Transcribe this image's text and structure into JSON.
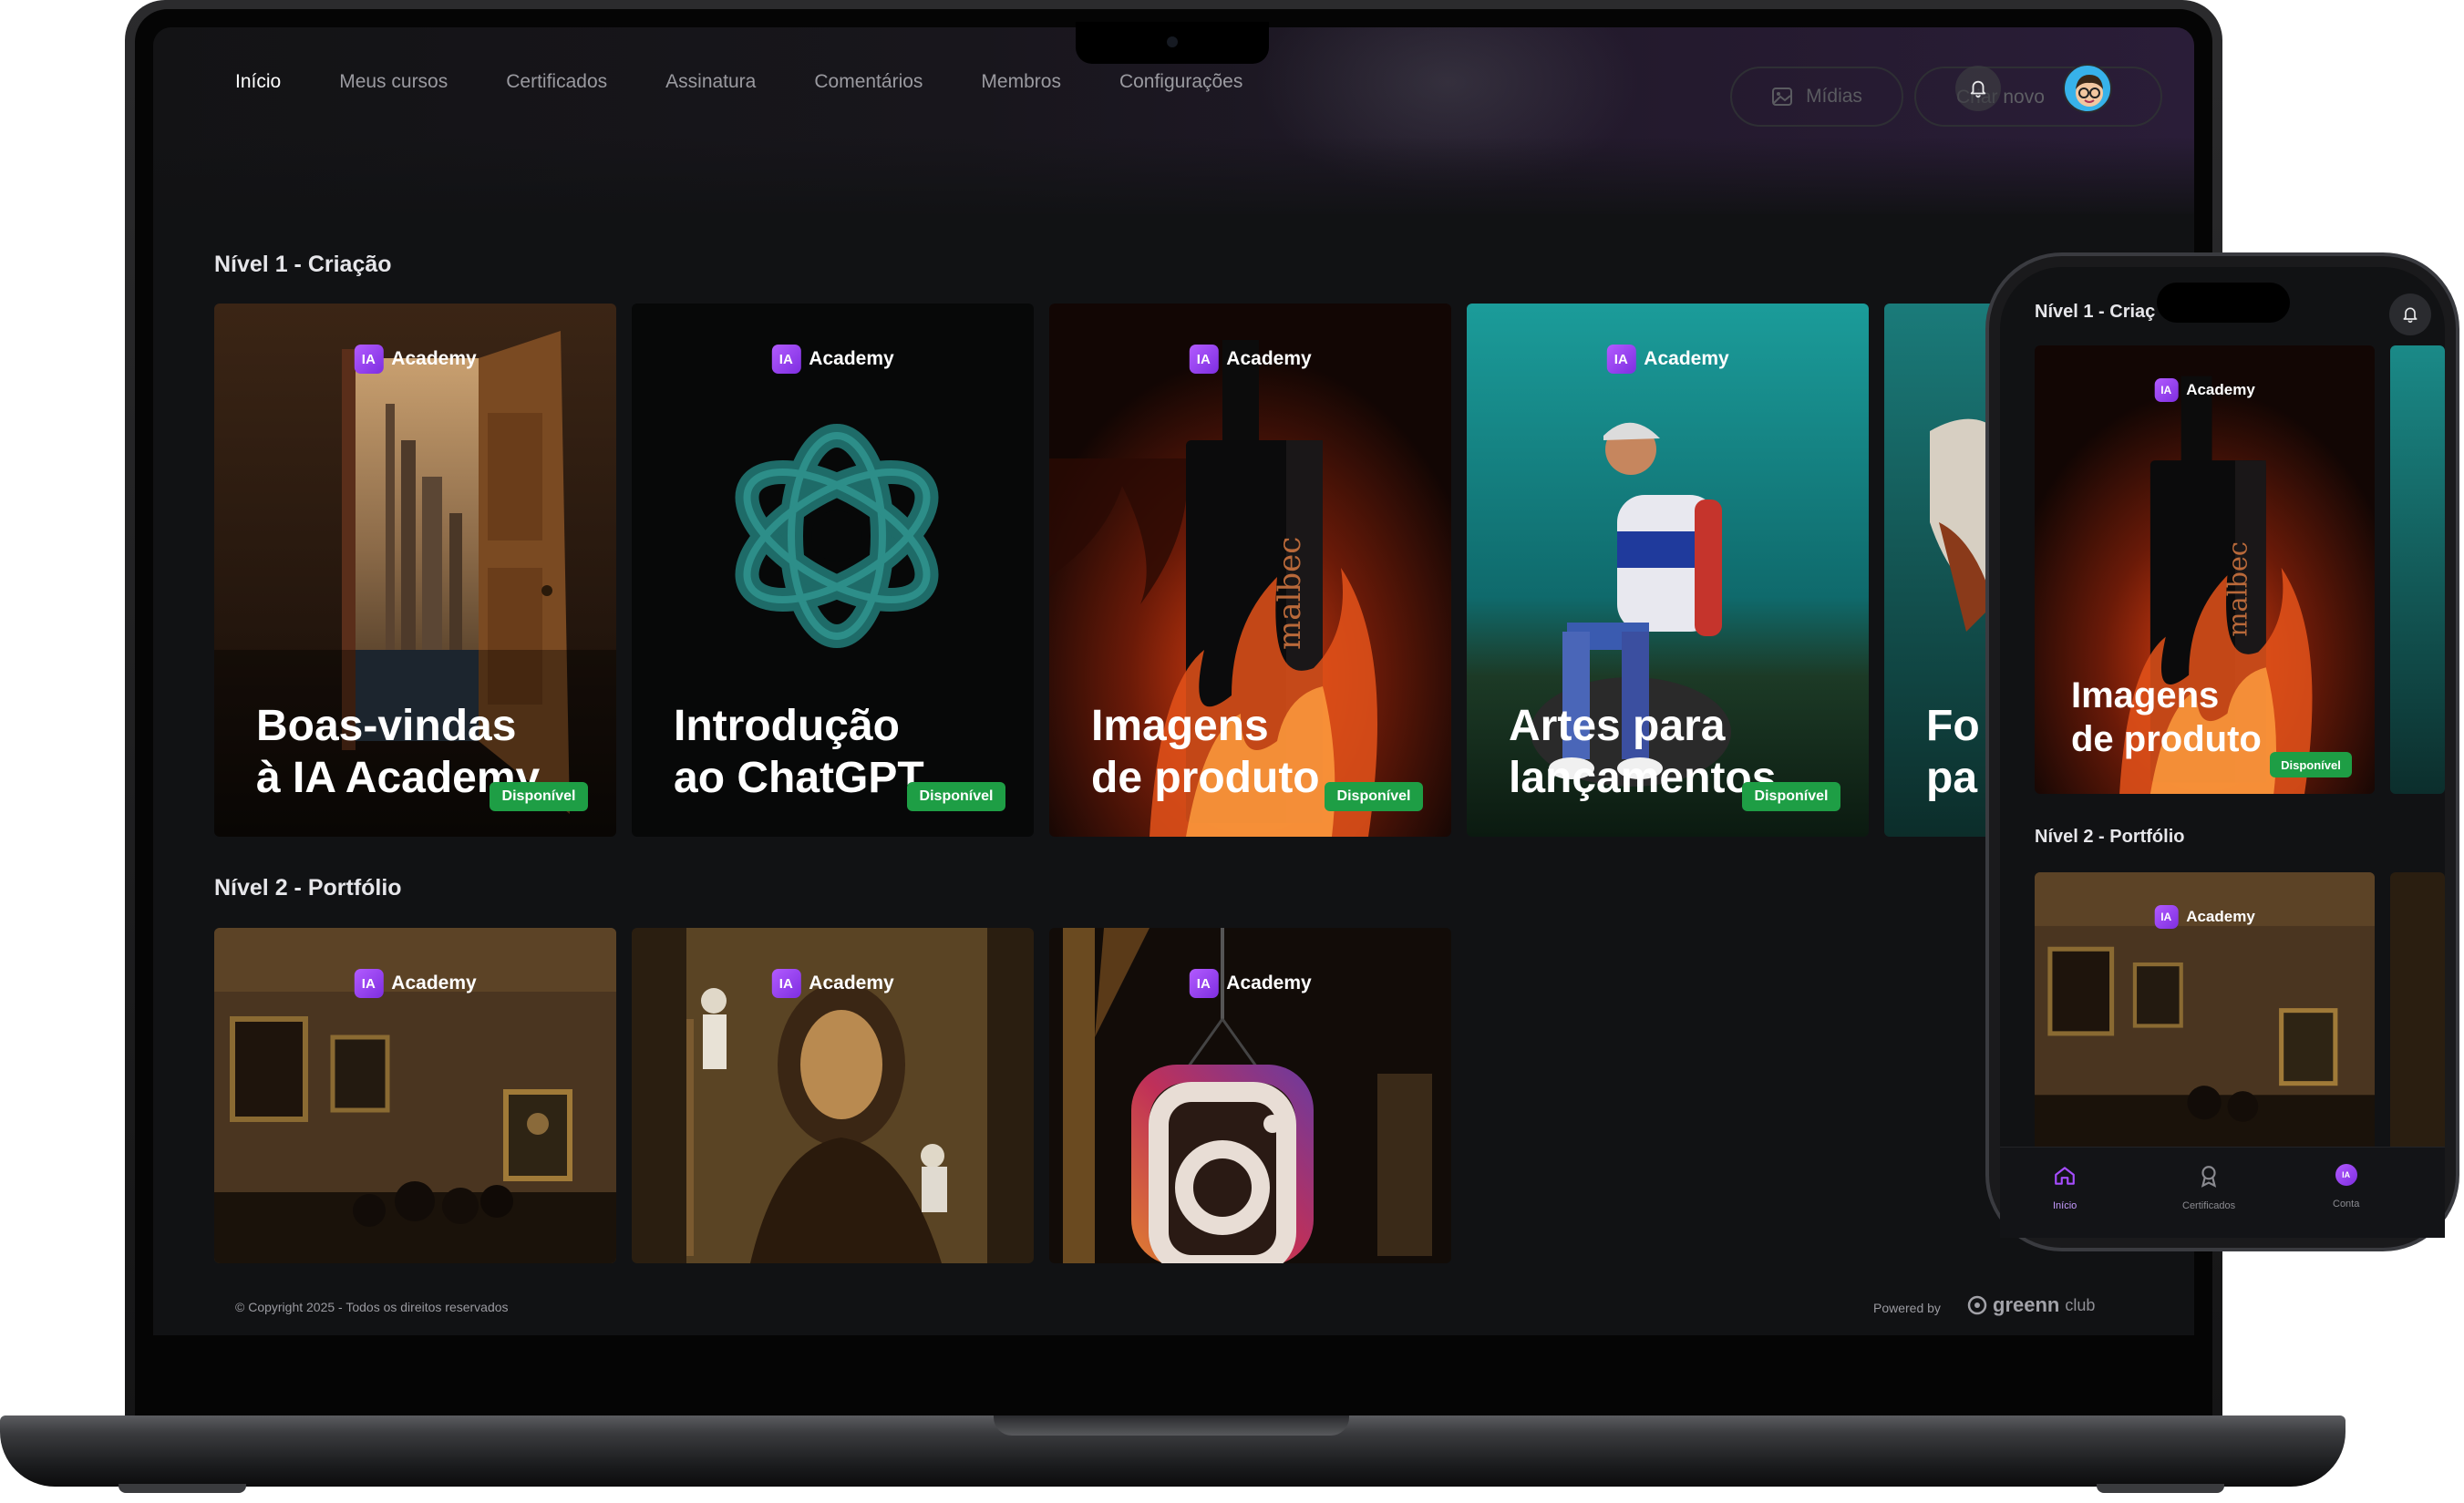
{
  "nav": {
    "items": [
      "Início",
      "Meus cursos",
      "Certificados",
      "Assinatura",
      "Comentários",
      "Membros",
      "Configurações"
    ],
    "media_label": "Mídias",
    "create_label": "Criar novo"
  },
  "brand": {
    "logo_mark": "IA",
    "logo_name": "Academy"
  },
  "sections": [
    {
      "title": "Nível 1 - Criação"
    },
    {
      "title": "Nível 2 - Portfólio"
    }
  ],
  "level1_cards": [
    {
      "title": "Boas-vindas\nà IA Academy",
      "badge": "Disponível"
    },
    {
      "title": "Introdução\nao ChatGPT",
      "badge": "Disponível"
    },
    {
      "title": "Imagens\nde produto",
      "badge": "Disponível"
    },
    {
      "title": "Artes para\nlançamentos",
      "badge": "Disponível"
    },
    {
      "title": "Fo\npa"
    }
  ],
  "footer": {
    "copyright": "© Copyright 2025 - Todos os direitos reservados",
    "powered_by": "Powered by",
    "brand_main": "greenn",
    "brand_sub": "club"
  },
  "phone": {
    "section1": "Nível 1 - Criaç",
    "section2": "Nível 2 - Portfólio",
    "card_title": "Imagens\nde produto",
    "badge": "Disponível",
    "tabs": [
      "Início",
      "Certificados",
      "Conta"
    ]
  },
  "colors": {
    "accent": "#a64dff",
    "badge_green": "#1e9e45",
    "background": "#111214"
  },
  "icons": [
    "bell-icon",
    "image-icon",
    "home-icon",
    "award-icon",
    "account-icon"
  ]
}
